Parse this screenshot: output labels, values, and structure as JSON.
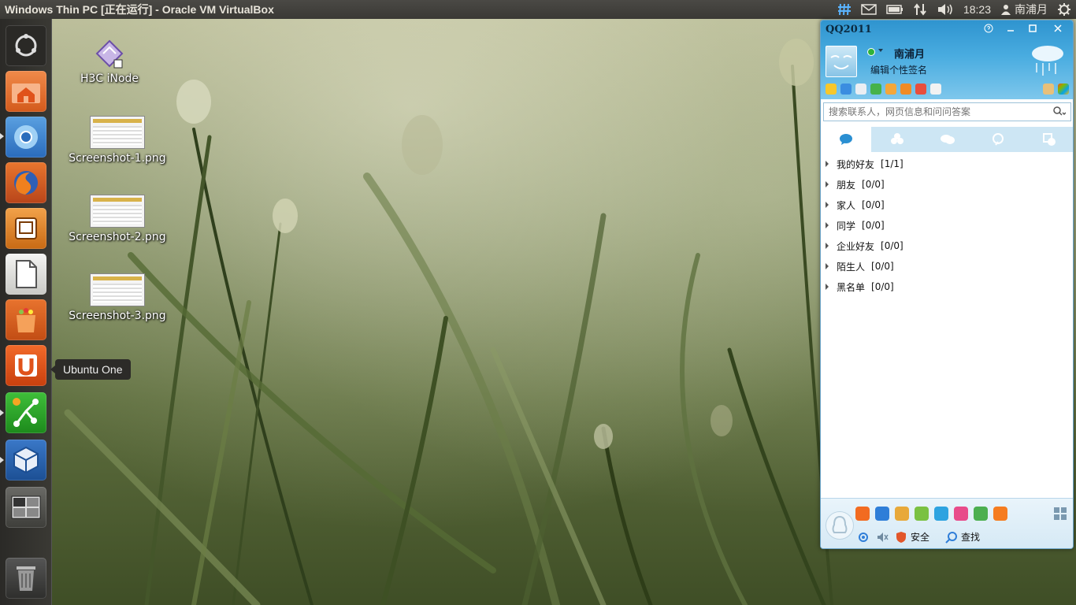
{
  "top_panel": {
    "window_title": "Windows Thin PC [正在运行] - Oracle VM VirtualBox",
    "clock": "18:23",
    "user": "南浦月",
    "indicators": [
      "keyboard-icon",
      "mail-icon",
      "battery-icon",
      "network-icon",
      "volume-icon",
      "power-icon"
    ]
  },
  "launcher": {
    "items": [
      "dash-home",
      "home-folder",
      "chromium",
      "firefox",
      "thunderbird",
      "libreoffice",
      "software-center",
      "ubuntu-one",
      "gitg",
      "virtualbox",
      "workspace-switcher",
      "trash"
    ]
  },
  "desktop": {
    "icons": [
      {
        "label": "H3C iNode"
      },
      {
        "label": "Screenshot-1.png"
      },
      {
        "label": "Screenshot-2.png"
      },
      {
        "label": "Screenshot-3.png"
      }
    ],
    "tooltip": "Ubuntu One"
  },
  "qq": {
    "title": "QQ2011",
    "nickname": "南浦月",
    "signature": "编辑个性签名",
    "search_placeholder": "搜索联系人，网页信息和问问答案",
    "groups": [
      {
        "name": "我的好友",
        "count": "[1/1]"
      },
      {
        "name": "朋友",
        "count": "[0/0]"
      },
      {
        "name": "家人",
        "count": "[0/0]"
      },
      {
        "name": "同学",
        "count": "[0/0]"
      },
      {
        "name": "企业好友",
        "count": "[0/0]"
      },
      {
        "name": "陌生人",
        "count": "[0/0]"
      },
      {
        "name": "黑名单",
        "count": "[0/0]"
      }
    ],
    "bottom": {
      "security_label": "安全",
      "find_label": "查找"
    },
    "colors": {
      "header": "#3aa0d8",
      "accent": "#2fb23a"
    }
  }
}
